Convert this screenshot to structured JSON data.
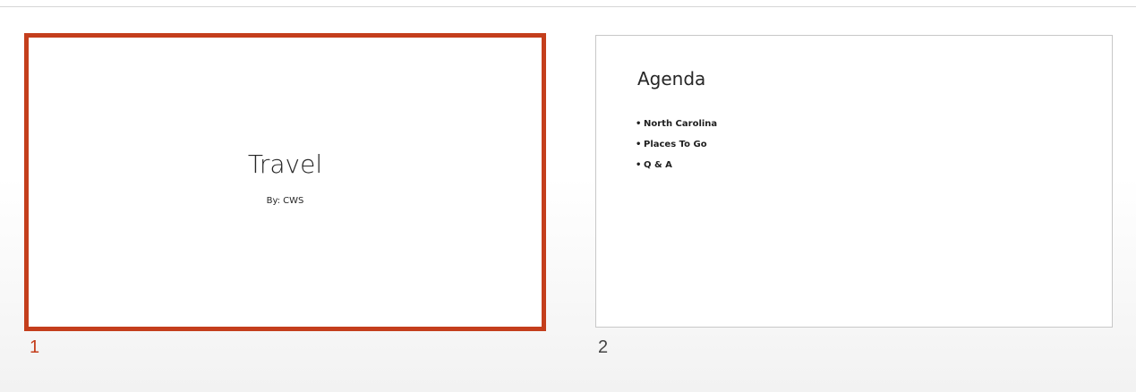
{
  "slides": [
    {
      "number": "1",
      "selected": true,
      "title": "Travel",
      "subtitle": "By: CWS"
    },
    {
      "number": "2",
      "selected": false,
      "title": "Agenda",
      "bullets": [
        "North Carolina",
        "Places To Go",
        "Q & A"
      ]
    }
  ],
  "colors": {
    "selection_accent": "#c43e1c",
    "thumbnail_border": "#c8c8c8"
  }
}
